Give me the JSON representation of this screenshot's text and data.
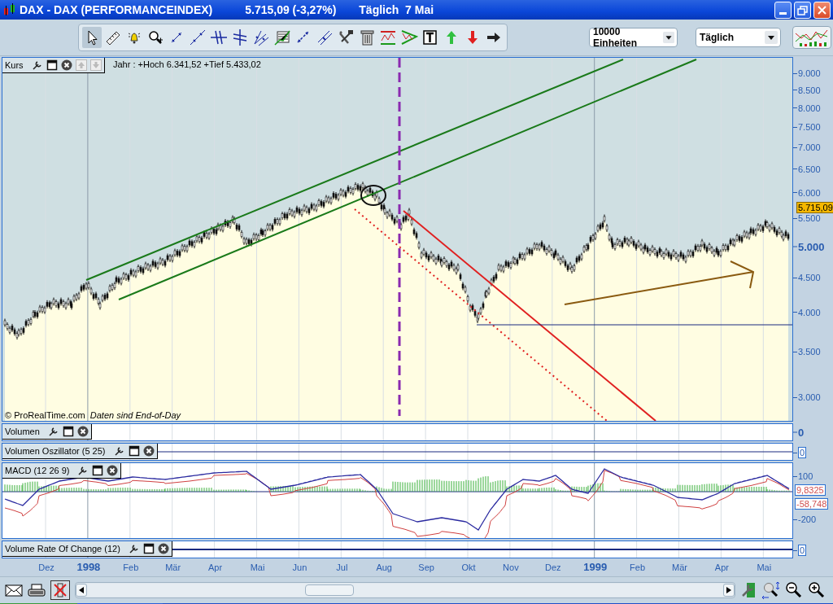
{
  "window": {
    "title": "DAX - DAX (PERFORMANCEINDEX)",
    "quote": "5.715,09 (-3,27%)",
    "period": "Täglich  7 Mai"
  },
  "toolbar": {
    "units": "10000 Einheiten",
    "interval": "Täglich"
  },
  "price_panel": {
    "title": "Kurs",
    "info": "Jahr : +Hoch 6.341,52 +Tief 5.433,02",
    "copyright": "© ProRealTime.com",
    "note": "Daten sind End-of-Day",
    "last_price": "5.715,09",
    "y_ticks": [
      {
        "label": "9.000",
        "bold": false
      },
      {
        "label": "8.500",
        "bold": false
      },
      {
        "label": "8.000",
        "bold": false
      },
      {
        "label": "7.500",
        "bold": false
      },
      {
        "label": "7.000",
        "bold": false
      },
      {
        "label": "6.500",
        "bold": false
      },
      {
        "label": "6.000",
        "bold": false
      },
      {
        "label": "5.500",
        "bold": false
      },
      {
        "label": "5.000",
        "bold": true
      },
      {
        "label": "4.500",
        "bold": false
      },
      {
        "label": "4.000",
        "bold": false
      },
      {
        "label": "3.500",
        "bold": false
      },
      {
        "label": "3.000",
        "bold": false
      }
    ]
  },
  "indicators": [
    {
      "kind": "empty",
      "title": "Volumen",
      "axis": [
        "0"
      ]
    },
    {
      "kind": "line",
      "title": "Volumen Oszillator (5 25)",
      "axis": [
        "0"
      ]
    },
    {
      "kind": "macd",
      "title": "MACD (12 26 9)",
      "axis": [
        "100",
        "-200"
      ],
      "values": [
        "9,8325",
        "-58,748"
      ]
    },
    {
      "kind": "line",
      "title": "Volume Rate Of Change (12)",
      "axis": [
        "0"
      ]
    }
  ],
  "x_axis": [
    {
      "label": "Dez",
      "bold": false
    },
    {
      "label": "1998",
      "bold": true
    },
    {
      "label": "Feb",
      "bold": false
    },
    {
      "label": "Mär",
      "bold": false
    },
    {
      "label": "Apr",
      "bold": false
    },
    {
      "label": "Mai",
      "bold": false
    },
    {
      "label": "Jun",
      "bold": false
    },
    {
      "label": "Jul",
      "bold": false
    },
    {
      "label": "Aug",
      "bold": false
    },
    {
      "label": "Sep",
      "bold": false
    },
    {
      "label": "Okt",
      "bold": false
    },
    {
      "label": "Nov",
      "bold": false
    },
    {
      "label": "Dez",
      "bold": false
    },
    {
      "label": "1999",
      "bold": true
    },
    {
      "label": "Feb",
      "bold": false
    },
    {
      "label": "Mär",
      "bold": false
    },
    {
      "label": "Apr",
      "bold": false
    },
    {
      "label": "Mai",
      "bold": false
    }
  ]
}
